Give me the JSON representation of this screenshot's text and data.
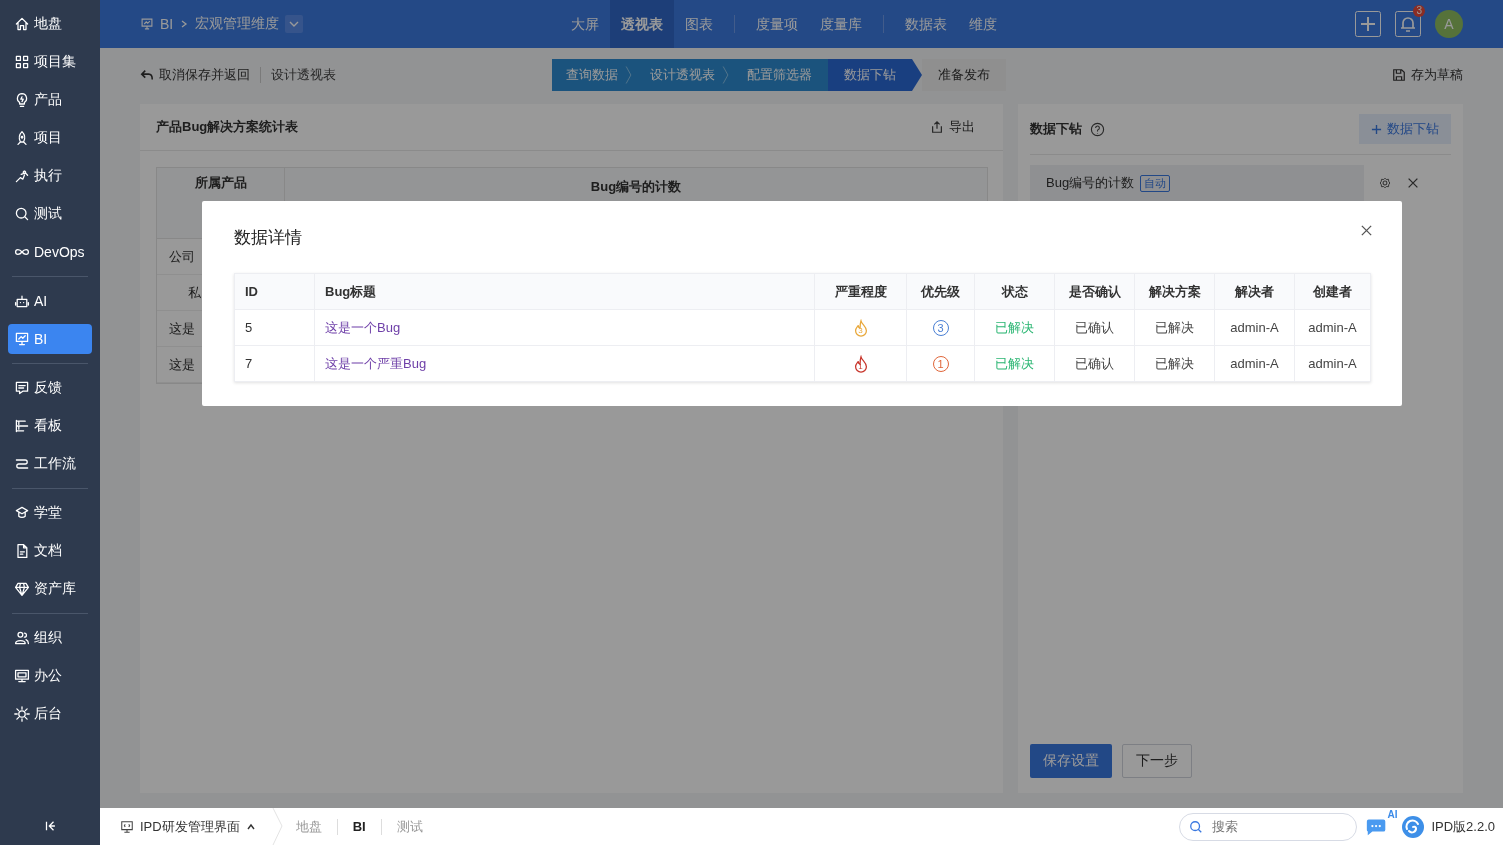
{
  "sidebar": {
    "groups": [
      [
        {
          "label": "地盘",
          "selected": false
        },
        {
          "label": "项目集",
          "selected": false
        },
        {
          "label": "产品",
          "selected": false
        },
        {
          "label": "项目",
          "selected": false
        },
        {
          "label": "执行",
          "selected": false
        },
        {
          "label": "测试",
          "selected": false
        },
        {
          "label": "DevOps",
          "selected": false
        }
      ],
      [
        {
          "label": "AI",
          "selected": false
        },
        {
          "label": "BI",
          "selected": true
        }
      ],
      [
        {
          "label": "反馈",
          "selected": false
        },
        {
          "label": "看板",
          "selected": false
        },
        {
          "label": "工作流",
          "selected": false
        }
      ],
      [
        {
          "label": "学堂",
          "selected": false
        },
        {
          "label": "文档",
          "selected": false
        },
        {
          "label": "资产库",
          "selected": false
        }
      ],
      [
        {
          "label": "组织",
          "selected": false
        },
        {
          "label": "办公",
          "selected": false
        },
        {
          "label": "后台",
          "selected": false
        }
      ]
    ]
  },
  "top_bar": {
    "breadcrumb": [
      "BI",
      "宏观管理维度"
    ],
    "nav_groups": [
      [
        {
          "label": "大屏",
          "selected": false
        },
        {
          "label": "透视表",
          "selected": true
        },
        {
          "label": "图表",
          "selected": false
        }
      ],
      [
        {
          "label": "度量项",
          "selected": false
        },
        {
          "label": "度量库",
          "selected": false
        }
      ],
      [
        {
          "label": "数据表",
          "selected": false
        },
        {
          "label": "维度",
          "selected": false
        }
      ]
    ],
    "notification_count": "3",
    "avatar": "A"
  },
  "toolbar": {
    "back": "取消保存并返回",
    "title": "设计透视表",
    "steps": [
      {
        "label": "查询数据",
        "kind": "done"
      },
      {
        "label": "设计透视表",
        "kind": "done"
      },
      {
        "label": "配置筛选器",
        "kind": "done"
      },
      {
        "label": "数据下钻",
        "kind": "current"
      },
      {
        "label": "准备发布",
        "kind": "todo"
      }
    ],
    "save_draft": "存为草稿"
  },
  "pivot_panel": {
    "title": "产品Bug解决方案统计表",
    "export": "导出",
    "row_header": "所属产品",
    "value_header": "Bug编号的计数",
    "row_labels": [
      "公司",
      "私",
      "这是",
      "这是"
    ]
  },
  "drill_panel": {
    "title": "数据下钻",
    "add_button": "数据下钻",
    "items": [
      {
        "label": "Bug编号的计数",
        "tag": "自动"
      }
    ],
    "save_button": "保存设置",
    "next_button": "下一步"
  },
  "modal": {
    "title": "数据详情",
    "columns": [
      "ID",
      "Bug标题",
      "严重程度",
      "优先级",
      "状态",
      "是否确认",
      "解决方案",
      "解决者",
      "创建者"
    ],
    "rows": [
      {
        "id": "5",
        "title": "这是一个Bug",
        "severity": {
          "value": "3",
          "color": "#e9a83a"
        },
        "priority": {
          "value": "3",
          "color": "#4a7fd4"
        },
        "status": "已解决",
        "confirmed": "已确认",
        "resolution": "已解决",
        "resolver": "admin-A",
        "creator": "admin-A"
      },
      {
        "id": "7",
        "title": "这是一个严重Bug",
        "severity": {
          "value": "1",
          "color": "#c8352b"
        },
        "priority": {
          "value": "1",
          "color": "#e0663a"
        },
        "status": "已解决",
        "confirmed": "已确认",
        "resolution": "已解决",
        "resolver": "admin-A",
        "creator": "admin-A"
      }
    ]
  },
  "bottom_bar": {
    "app": "IPD研发管理界面",
    "crumbs": [
      {
        "label": "地盘",
        "selected": false
      },
      {
        "label": "BI",
        "selected": true
      },
      {
        "label": "测试",
        "selected": false
      }
    ],
    "search_placeholder": "搜索",
    "ai_label": "AI",
    "version": "IPD版2.2.0"
  }
}
